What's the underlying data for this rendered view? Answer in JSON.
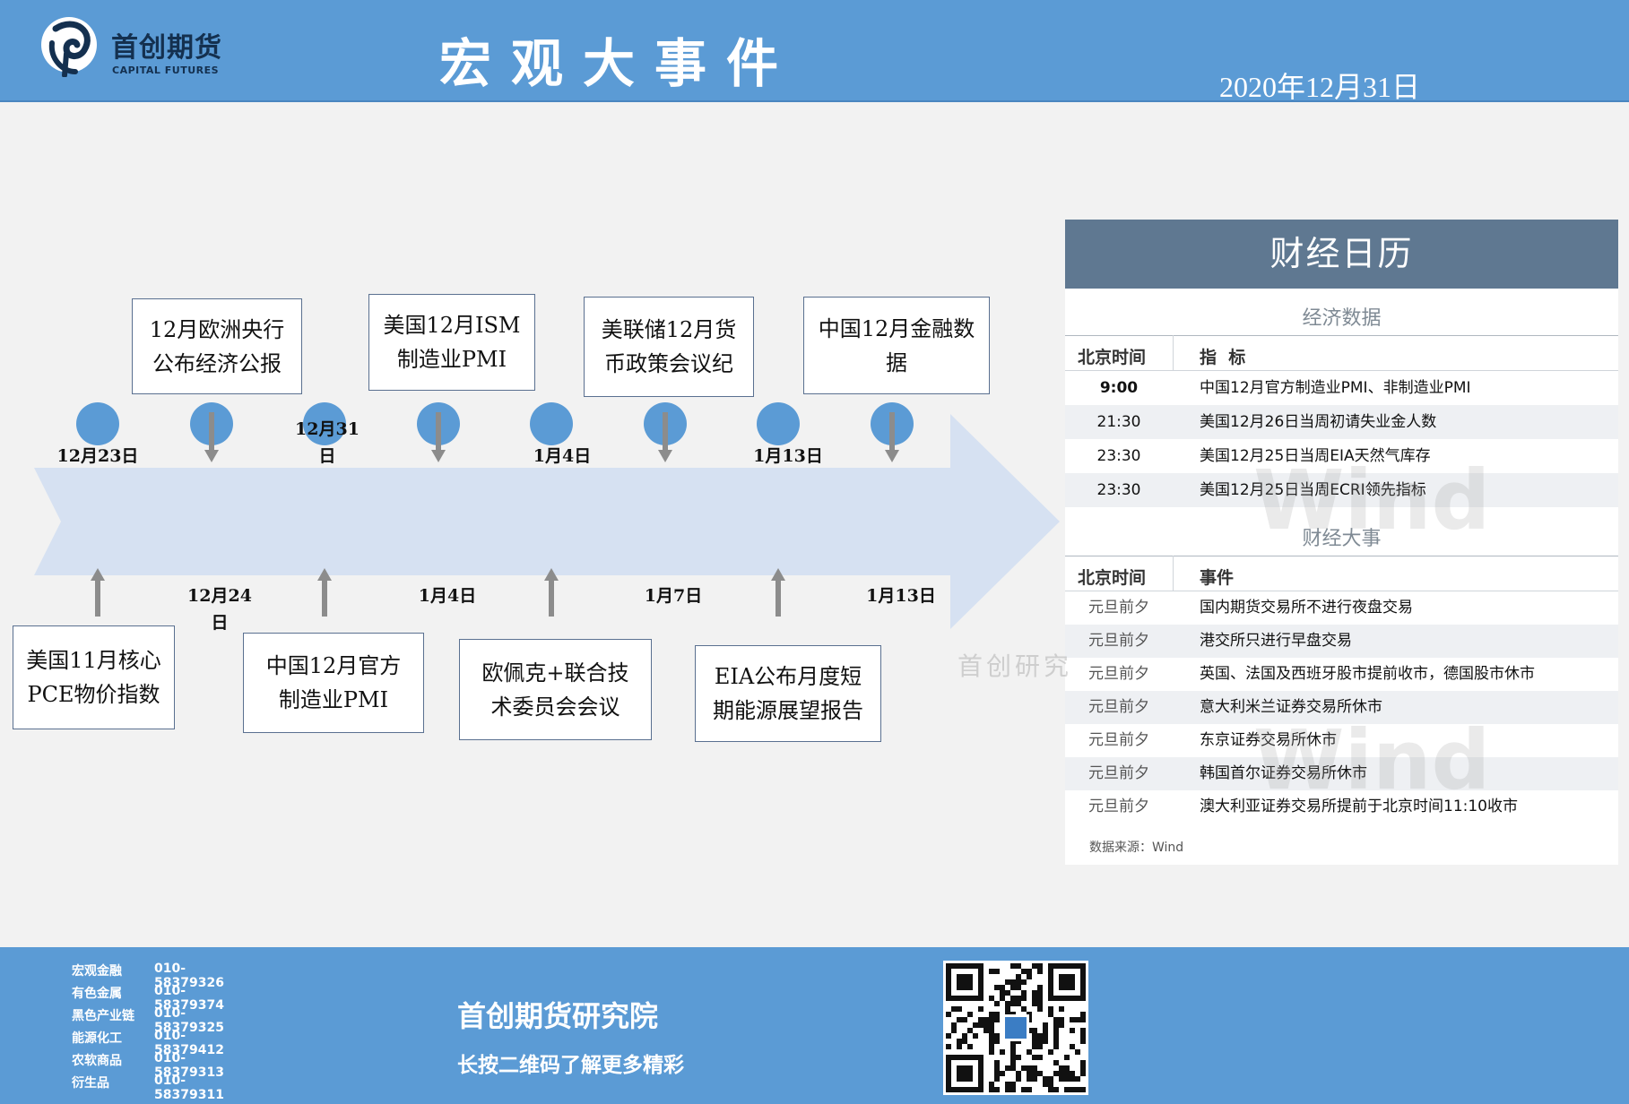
{
  "header": {
    "logo_cn": "首创期货",
    "logo_en": "CAPITAL FUTURES",
    "title": "宏观大事件",
    "date": "2020年12月31日"
  },
  "timeline": {
    "top_events": [
      {
        "label": "12月欧洲央行\n公布经济公报"
      },
      {
        "label": "美国12月ISM\n制造业PMI"
      },
      {
        "label": "美联储12月货\n币政策会议纪"
      },
      {
        "label": "中国12月金融数\n据"
      }
    ],
    "bottom_events": [
      {
        "label": "美国11月核心\nPCE物价指数"
      },
      {
        "label": "中国12月官方\n制造业PMI"
      },
      {
        "label": "欧佩克+联合技\n术委员会会议"
      },
      {
        "label": "EIA公布月度短\n期能源展望报告"
      }
    ],
    "top_dates": [
      "12月23日",
      "12月31\n日",
      "1月4日",
      "1月13日"
    ],
    "bottom_dates": [
      "12月24\n日",
      "1月4日",
      "1月7日",
      "1月13日"
    ]
  },
  "calendar": {
    "title": "财经日历",
    "econ_section": "经济数据",
    "econ_head": {
      "time": "北京时间",
      "item": "指  标"
    },
    "econ_rows": [
      {
        "time": "9:00",
        "item": "中国12月官方制造业PMI、非制造业PMI"
      },
      {
        "time": "21:30",
        "item": "美国12月26日当周初请失业金人数"
      },
      {
        "time": "23:30",
        "item": "美国12月25日当周EIA天然气库存"
      },
      {
        "time": "23:30",
        "item": "美国12月25日当周ECRI领先指标"
      }
    ],
    "event_section": "财经大事",
    "event_head": {
      "time": "北京时间",
      "item": "事件"
    },
    "event_rows": [
      {
        "time": "元旦前夕",
        "item": "国内期货交易所不进行夜盘交易"
      },
      {
        "time": "元旦前夕",
        "item": "港交所只进行早盘交易"
      },
      {
        "time": "元旦前夕",
        "item": "英国、法国及西班牙股市提前收市，德国股市休市"
      },
      {
        "time": "元旦前夕",
        "item": "意大利米兰证券交易所休市"
      },
      {
        "time": "元旦前夕",
        "item": "东京证券交易所休市"
      },
      {
        "time": "元旦前夕",
        "item": "韩国首尔证券交易所休市"
      },
      {
        "time": "元旦前夕",
        "item": "澳大利亚证券交易所提前于北京时间11:10收市"
      }
    ],
    "source": "数据来源：Wind"
  },
  "watermarks": {
    "wind": "Wind",
    "cn": "首创研究"
  },
  "footer": {
    "contacts": [
      {
        "name": "宏观金融",
        "phone": "010-58379326"
      },
      {
        "name": "有色金属",
        "phone": "010-58379374"
      },
      {
        "name": "黑色产业链",
        "phone": "010-58379325"
      },
      {
        "name": "能源化工",
        "phone": "010-58379412"
      },
      {
        "name": "农软商品",
        "phone": "010-58379313"
      },
      {
        "name": "衍生品",
        "phone": "010-58379311"
      }
    ],
    "org_name": "首创期货研究院",
    "slogan": "长按二维码了解更多精彩",
    "qr_icon": "qr-code-icon"
  },
  "colors": {
    "header_blue": "#5b9bd5",
    "arrow_fill": "#d6e1f2",
    "node_blue": "#5b9bd5",
    "calendar_title": "#5f7891"
  }
}
